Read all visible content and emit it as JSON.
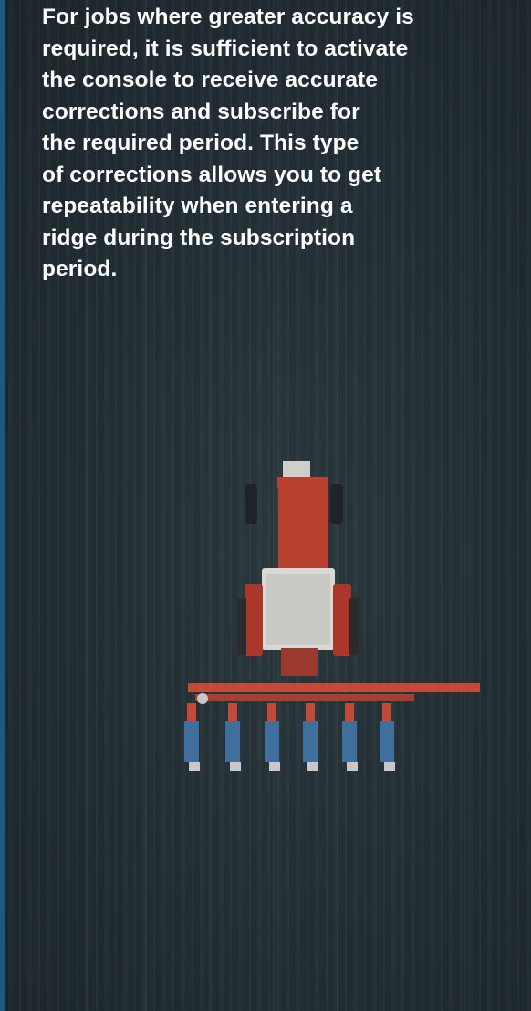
{
  "description": {
    "lines": [
      "For jobs where greater accuracy is",
      "required, it is sufficient to activate",
      "the console to receive accurate",
      "corrections and subscribe for",
      "the required period. This type",
      "of corrections allows you to get",
      "repeatability when entering a",
      "ridge during the subscription",
      "period."
    ]
  },
  "image": {
    "icon": "tractor-planter-photo",
    "colors": {
      "soil": "#243137",
      "tractor": "#b8412f",
      "cab": "#d9d9d6",
      "planter": "#c24a38",
      "row_units": "#3f6f9c",
      "accent": "#1f5a78"
    }
  }
}
